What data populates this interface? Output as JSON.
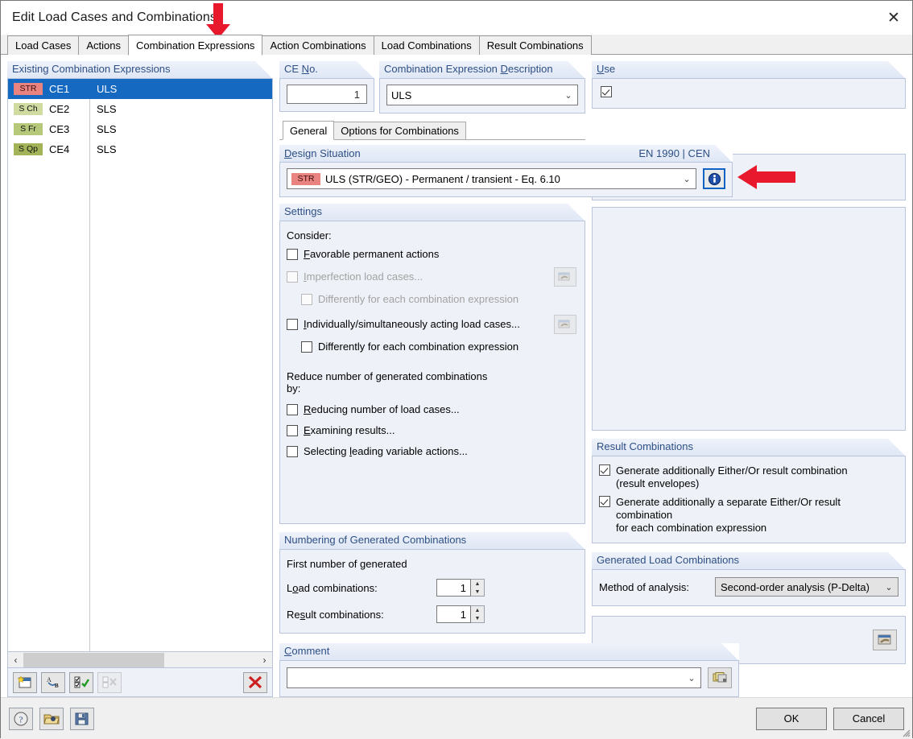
{
  "window": {
    "title": "Edit Load Cases and Combinations",
    "close_label": "✕"
  },
  "tabs": [
    {
      "label": "Load Cases",
      "active": false
    },
    {
      "label": "Actions",
      "active": false
    },
    {
      "label": "Combination Expressions",
      "active": true
    },
    {
      "label": "Action Combinations",
      "active": false
    },
    {
      "label": "Load Combinations",
      "active": false
    },
    {
      "label": "Result Combinations",
      "active": false
    }
  ],
  "existing": {
    "header": "Existing Combination Expressions",
    "rows": [
      {
        "badge": "STR",
        "name": "CE1",
        "value": "ULS",
        "selected": true
      },
      {
        "badge": "S Ch",
        "name": "CE2",
        "value": "SLS",
        "selected": false
      },
      {
        "badge": "S Fr",
        "name": "CE3",
        "value": "SLS",
        "selected": false
      },
      {
        "badge": "S Qp",
        "name": "CE4",
        "value": "SLS",
        "selected": false
      }
    ],
    "toolbar": [
      {
        "name": "new-combination-expression-icon",
        "enabled": true
      },
      {
        "name": "rename-icon",
        "enabled": true
      },
      {
        "name": "select-all-icon",
        "enabled": true
      },
      {
        "name": "deselect-all-icon",
        "enabled": false
      },
      {
        "name": "delete-icon",
        "enabled": true
      }
    ],
    "scroll_left": "‹",
    "scroll_right": "›"
  },
  "ce_no": {
    "header": "CE No.",
    "header_underline": "N",
    "value": "1"
  },
  "description": {
    "header": "Combination Expression Description",
    "value": "ULS"
  },
  "use": {
    "header": "Use",
    "checked": true
  },
  "subtabs": [
    {
      "label": "General",
      "active": true
    },
    {
      "label": "Options for Combinations",
      "active": false
    }
  ],
  "design_situation": {
    "header": "Design Situation",
    "standard": "EN 1990 | CEN",
    "badge": "STR",
    "value": "ULS (STR/GEO) - Permanent / transient - Eq. 6.10",
    "info_button": "i"
  },
  "settings": {
    "header": "Settings",
    "consider_label": "Consider:",
    "items": [
      {
        "label": "Favorable permanent actions",
        "checked": false,
        "enabled": true,
        "indent": 0,
        "has_button": false
      },
      {
        "label": "Imperfection load cases...",
        "checked": false,
        "enabled": false,
        "indent": 0,
        "has_button": true
      },
      {
        "label": "Differently for each combination expression",
        "checked": false,
        "enabled": false,
        "indent": 1,
        "has_button": false
      },
      {
        "label": "Individually/simultaneously acting load cases...",
        "checked": false,
        "enabled": true,
        "indent": 0,
        "has_button": true
      },
      {
        "label": "Differently for each combination expression",
        "checked": false,
        "enabled": true,
        "indent": 1,
        "has_button": false
      }
    ],
    "reduce_label_line1": "Reduce number of generated combinations",
    "reduce_label_line2": "by:",
    "reduce_items": [
      {
        "label": "Reducing number of load cases...",
        "checked": false
      },
      {
        "label": "Examining results...",
        "checked": false
      },
      {
        "label": "Selecting leading variable actions...",
        "checked": false
      }
    ]
  },
  "numbering": {
    "header": "Numbering of Generated Combinations",
    "first_number_label": "First number of generated",
    "load_label": "Load combinations:",
    "load_value": "1",
    "result_label": "Result combinations:",
    "result_value": "1"
  },
  "result_combinations": {
    "header": "Result Combinations",
    "items": [
      {
        "line1": "Generate additionally Either/Or result combination",
        "line2": "(result envelopes)",
        "checked": true
      },
      {
        "line1": "Generate additionally a separate Either/Or result combination",
        "line2": "for each combination expression",
        "checked": true
      }
    ]
  },
  "generated_load_combinations": {
    "header": "Generated Load Combinations",
    "method_label": "Method of analysis:",
    "method_value": "Second-order analysis (P-Delta)"
  },
  "comment": {
    "header": "Comment",
    "value": "",
    "placeholder": ""
  },
  "footer": {
    "help_icon": "help-icon",
    "open_icon": "open-folder-icon",
    "save_icon": "save-icon",
    "ok_label": "OK",
    "cancel_label": "Cancel"
  },
  "colors": {
    "selection_blue": "#1669c1",
    "group_header_text": "#2d4f85",
    "annotation_red": "#e8192c",
    "badge_str": "#e8837f",
    "badge_sch": "#cfdba0",
    "badge_sfr": "#b6c97a",
    "badge_sqp": "#a2b358",
    "info_focus": "#1062c4"
  }
}
